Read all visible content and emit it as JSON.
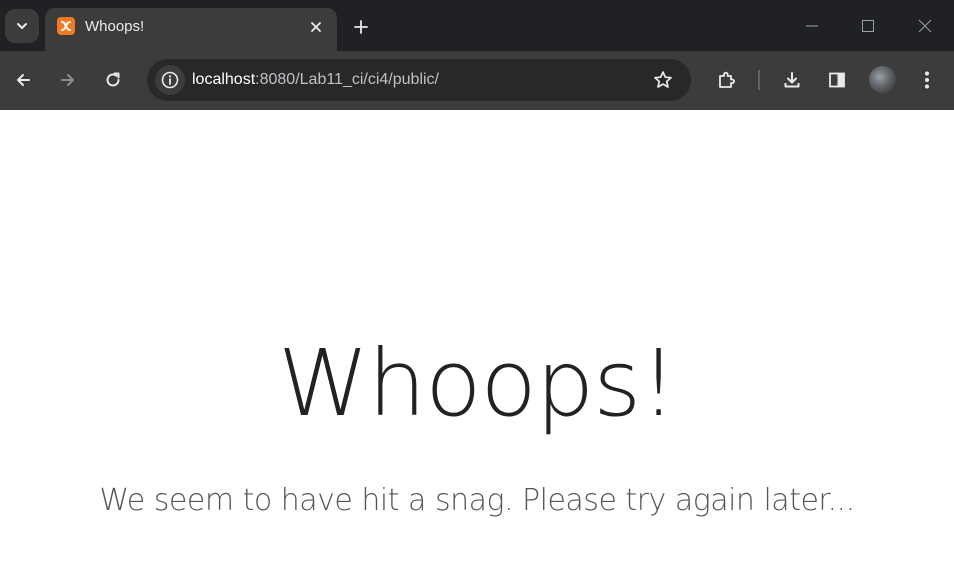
{
  "browser": {
    "tab": {
      "title": "Whoops!",
      "favicon": "xampp-icon",
      "favicon_color": "#f27a22"
    },
    "address_bar": {
      "url_host": "localhost",
      "url_rest": ":8080/Lab11_ci/ci4/public/"
    },
    "colors": {
      "tabstrip": "#202124",
      "toolbar": "#3c3c3c"
    }
  },
  "page": {
    "headline": "Whoops!",
    "message": "We seem to have hit a snag. Please try again later..."
  }
}
